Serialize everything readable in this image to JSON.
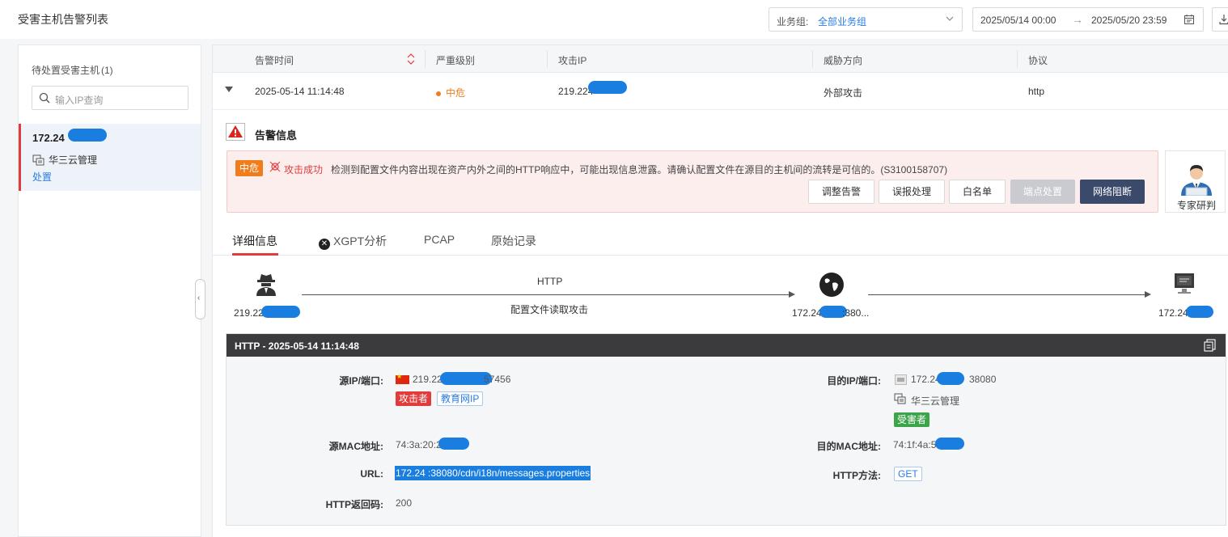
{
  "header": {
    "title": "受害主机告警列表",
    "biz_group_label": "业务组:",
    "biz_group_value": "全部业务组",
    "date_start": "2025/05/14 00:00",
    "date_arrow": "→",
    "date_end": "2025/05/20 23:59"
  },
  "left_panel": {
    "title": "待处置受害主机",
    "count": "(1)",
    "search_placeholder": "输入IP查询",
    "host": {
      "ip": "172.24",
      "org": "华三云管理",
      "action": "处置"
    },
    "collapse_glyph": "‹"
  },
  "table": {
    "headers": [
      "告警时间",
      "严重级别",
      "攻击IP",
      "威胁方向",
      "协议"
    ],
    "row": {
      "time": "2025-05-14 11:14:48",
      "severity": "中危",
      "attack_ip": "219.224",
      "direction": "外部攻击",
      "protocol": "http"
    }
  },
  "alert": {
    "section_title": "告警信息",
    "severity_tag": "中危",
    "result": "攻击成功",
    "description": "检测到配置文件内容出现在资产内外之间的HTTP响应中，可能出现信息泄露。请确认配置文件在源目的主机间的流转是可信的。(S3100158707)",
    "buttons": [
      "调整告警",
      "误报处理",
      "白名单",
      "端点处置",
      "网络阻断"
    ],
    "expert_label": "专家研判"
  },
  "tabs": [
    "详细信息",
    "XGPT分析",
    "PCAP",
    "原始记录"
  ],
  "flow": {
    "protocol": "HTTP",
    "description": "配置文件读取攻击",
    "src_label": "219.22",
    "mid_label": "172.24",
    "mid_suffix": ":380...",
    "dst_label": "172.24"
  },
  "detail": {
    "header": "HTTP - 2025-05-14 11:14:48",
    "src_label": "源IP/端口:",
    "src_value": "219.22",
    "src_port": "57456",
    "src_tags": [
      "攻击者",
      "教育网IP"
    ],
    "dst_label": "目的IP/端口:",
    "dst_value": "172.24",
    "dst_port": "38080",
    "dst_org": "华三云管理",
    "dst_tag": "受害者",
    "src_mac_label": "源MAC地址:",
    "src_mac": "74:3a:20:2",
    "dst_mac_label": "目的MAC地址:",
    "dst_mac": "74:1f:4a:5",
    "url_label": "URL:",
    "url_value": "172.24         :38080/cdn/i18n/messages.properties",
    "method_label": "HTTP方法:",
    "method_value": "GET",
    "code_label": "HTTP返回码:",
    "code_value": "200"
  },
  "colors": {
    "accent": "#2a7de1",
    "danger": "#e23b3b",
    "warning": "#ef7d1c",
    "success": "#3ca54a",
    "primary_dark": "#3b4a6b"
  }
}
